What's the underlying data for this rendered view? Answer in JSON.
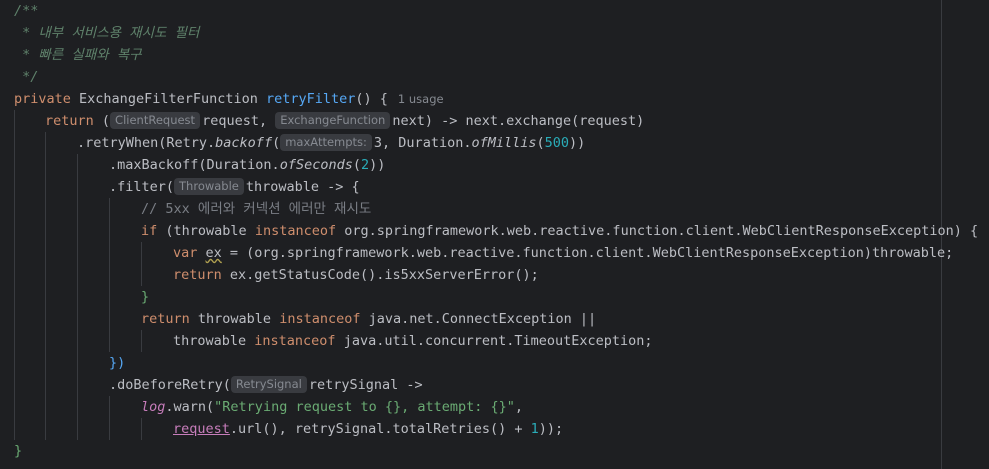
{
  "editor": {
    "doc_comment": [
      "/**",
      " * 내부 서비스용 재시도 필터",
      " * 빠른 실패와 복구",
      " */"
    ],
    "signature": {
      "modifier": "private",
      "type": "ExchangeFilterFunction",
      "name": "retryFilter",
      "params": "() {",
      "usage_hint": "1 usage"
    },
    "line_return": {
      "kw": "return",
      "open": " (",
      "hint1": "ClientRequest",
      "p1": "request, ",
      "hint2": "ExchangeFunction",
      "p2": "next) -> next.exchange(request)"
    },
    "line_retrywhen": {
      "a": ".retryWhen(Retry.",
      "backoff": "backoff",
      "b": "(",
      "hint": "maxAttempts:",
      "c": "3, Duration.",
      "ofmillis": "ofMillis",
      "d": "(",
      "num": "500",
      "e": "))"
    },
    "line_maxbackoff": {
      "a": ".maxBackoff(Duration.",
      "ofseconds": "ofSeconds",
      "b": "(",
      "num": "2",
      "c": "))"
    },
    "line_filter": {
      "a": ".filter(",
      "hint": "Throwable",
      "b": "throwable -> {"
    },
    "line_comment": "// 5xx 에러와 커넥션 에러만 재시도",
    "line_if": {
      "kw1": "if",
      "a": " (throwable ",
      "kw2": "instanceof",
      "b": " org.springframework.web.reactive.function.client.WebClientResponseException) {"
    },
    "line_var": {
      "kw": "var",
      "a": " ",
      "ex": "ex",
      "b": " = (org.springframework.web.reactive.function.client.WebClientResponseException)throwable;"
    },
    "line_return2": {
      "kw": "return",
      "a": " ex.getStatusCode().is5xxServerError();"
    },
    "line_closebrace1": "}",
    "line_return3": {
      "kw": "return",
      "a": " throwable ",
      "kw2": "instanceof",
      "b": " java.net.ConnectException ||"
    },
    "line_throwable": {
      "a": "throwable ",
      "kw": "instanceof",
      "b": " java.util.concurrent.TimeoutException;"
    },
    "line_closeparen": "})",
    "line_dobefore": {
      "a": ".doBeforeRetry(",
      "hint": "RetrySignal",
      "b": "retrySignal ->"
    },
    "line_log": {
      "log": "log",
      "a": ".warn(",
      "str": "\"Retrying request to {}, attempt: {}\"",
      "b": ","
    },
    "line_request": {
      "req": "request",
      "a": ".url(), retrySignal.totalRetries() + ",
      "num": "1",
      "b": "));"
    },
    "line_final": "}"
  }
}
